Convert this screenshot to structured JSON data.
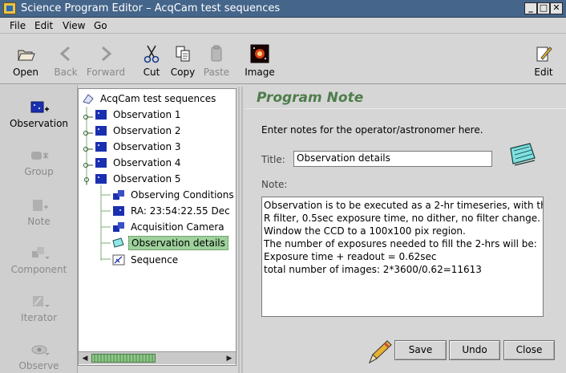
{
  "window": {
    "title": "Science Program Editor – AcqCam test sequences",
    "controls": [
      "_",
      "□",
      "✕"
    ]
  },
  "menu": [
    "File",
    "Edit",
    "View",
    "Go"
  ],
  "toolbar": [
    {
      "label": "Open",
      "icon": "folder-open-icon",
      "enabled": true
    },
    {
      "label": "Back",
      "icon": "back-arrow-icon",
      "enabled": false
    },
    {
      "label": "Forward",
      "icon": "forward-arrow-icon",
      "enabled": false
    },
    {
      "label": "Cut",
      "icon": "scissors-icon",
      "enabled": true
    },
    {
      "label": "Copy",
      "icon": "copy-icon",
      "enabled": true
    },
    {
      "label": "Paste",
      "icon": "paste-icon",
      "enabled": false
    },
    {
      "label": "Image",
      "icon": "sky-image-icon",
      "enabled": true
    },
    {
      "label": "Edit",
      "icon": "edit-pencil-icon",
      "enabled": true
    }
  ],
  "palette": [
    {
      "label": "Observation",
      "icon": "observation-add-icon",
      "enabled": true
    },
    {
      "label": "Group",
      "icon": "group-icon",
      "enabled": false
    },
    {
      "label": "Note",
      "icon": "note-add-icon",
      "enabled": false
    },
    {
      "label": "Component",
      "icon": "component-icon",
      "enabled": false
    },
    {
      "label": "Iterator",
      "icon": "iterator-icon",
      "enabled": false
    },
    {
      "label": "Observe",
      "icon": "observe-eye-icon",
      "enabled": false
    }
  ],
  "tree": {
    "root": "AcqCam test sequences",
    "observations": [
      "Observation 1",
      "Observation 2",
      "Observation 3",
      "Observation 4",
      "Observation 5"
    ],
    "children": [
      {
        "label": "Observing Conditions",
        "icon": "conditions-icon"
      },
      {
        "label": "RA: 23:54:22.55 Dec",
        "icon": "target-icon"
      },
      {
        "label": "Acquisition Camera",
        "icon": "camera-component-icon"
      },
      {
        "label": "Observation details",
        "icon": "note-icon",
        "selected": true
      },
      {
        "label": "Sequence",
        "icon": "sequence-icon"
      }
    ]
  },
  "content": {
    "heading": "Program Note",
    "intro": "Enter notes for the operator/astronomer here.",
    "title_label": "Title:",
    "title_value": "Observation details",
    "note_label": "Note:",
    "note_text": "Observation is to be executed as a 2-hr timeseries, with the\nR filter, 0.5sec exposure time, no dither, no filter change.\nWindow the CCD to a 100x100 pix region.\nThe number of exposures needed to fill the 2-hrs will be:\nExposure time + readout = 0.62sec\ntotal number of images: 2*3600/0.62=11613"
  },
  "buttons": {
    "save": "Save",
    "undo": "Undo",
    "close": "Close"
  },
  "colors": {
    "titlebar": "#45658a",
    "heading": "#4e7e4b",
    "selection": "#9ed19b"
  }
}
